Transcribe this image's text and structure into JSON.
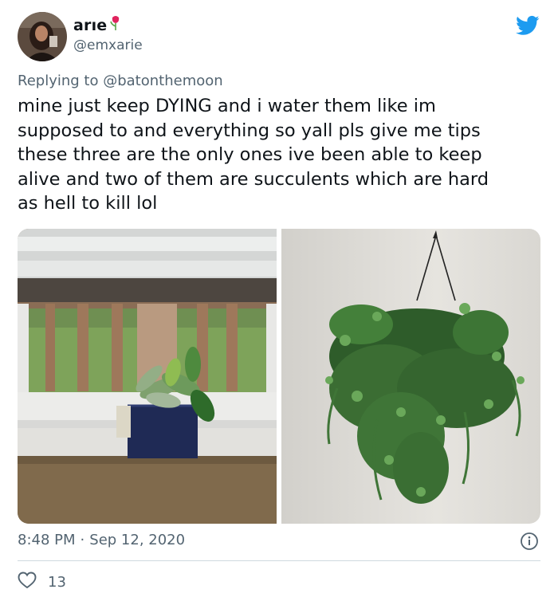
{
  "author": {
    "display_name": "arıe",
    "handle": "@emxarie"
  },
  "reply": {
    "prefix": "Replying to",
    "mention": "@batonthemoon"
  },
  "tweet": {
    "text": "mine just keep DYING and i water them like im\nsupposed to and everything so yall pls give me tips\nthese three are the only ones ive been able to keep\nalive and two of them are succulents which are hard\nas hell to kill lol"
  },
  "meta": {
    "time": "8:48 PM",
    "separator": "·",
    "date": "Sep 12, 2020"
  },
  "engagement": {
    "likes": "13"
  },
  "colors": {
    "twitter_blue": "#1d9bf0",
    "secondary_text": "#536471",
    "divider": "#cfd9de"
  },
  "icons": [
    "twitter-bird-icon",
    "rose-emoji-icon",
    "info-icon",
    "heart-icon"
  ]
}
